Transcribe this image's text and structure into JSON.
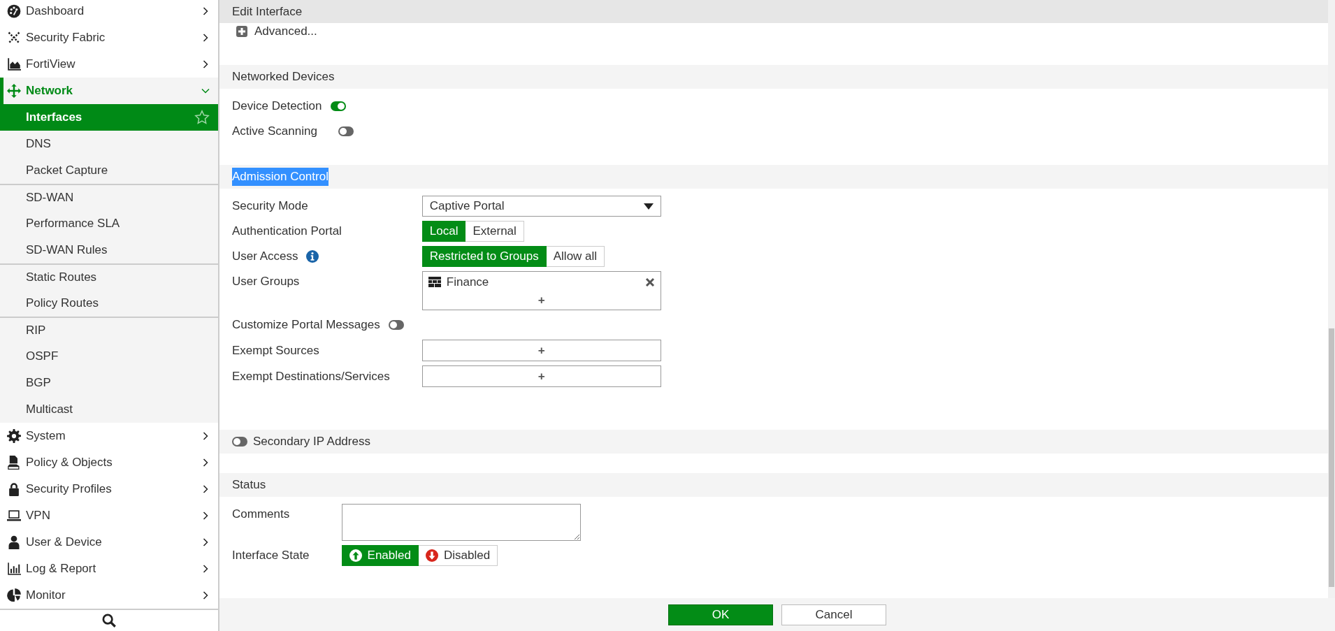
{
  "sidebar": {
    "items": [
      {
        "label": "Dashboard",
        "kind": "dashboard",
        "expanded": false
      },
      {
        "label": "Security Fabric",
        "kind": "fabric",
        "expanded": false
      },
      {
        "label": "FortiView",
        "kind": "area-chart",
        "expanded": false
      },
      {
        "label": "Network",
        "kind": "move",
        "expanded": true,
        "children": [
          {
            "label": "Interfaces",
            "selected": true,
            "section_start": false
          },
          {
            "label": "DNS",
            "selected": false,
            "section_start": false
          },
          {
            "label": "Packet Capture",
            "selected": false,
            "section_start": false
          },
          {
            "label": "SD-WAN",
            "selected": false,
            "section_start": true
          },
          {
            "label": "Performance SLA",
            "selected": false,
            "section_start": false
          },
          {
            "label": "SD-WAN Rules",
            "selected": false,
            "section_start": false
          },
          {
            "label": "Static Routes",
            "selected": false,
            "section_start": true
          },
          {
            "label": "Policy Routes",
            "selected": false,
            "section_start": false
          },
          {
            "label": "RIP",
            "selected": false,
            "section_start": true
          },
          {
            "label": "OSPF",
            "selected": false,
            "section_start": false
          },
          {
            "label": "BGP",
            "selected": false,
            "section_start": false
          },
          {
            "label": "Multicast",
            "selected": false,
            "section_start": false
          }
        ]
      },
      {
        "label": "System",
        "kind": "gear",
        "expanded": false
      },
      {
        "label": "Policy & Objects",
        "kind": "policy",
        "expanded": false
      },
      {
        "label": "Security Profiles",
        "kind": "lock",
        "expanded": false
      },
      {
        "label": "VPN",
        "kind": "laptop",
        "expanded": false
      },
      {
        "label": "User & Device",
        "kind": "user",
        "expanded": false
      },
      {
        "label": "Log & Report",
        "kind": "bar-chart",
        "expanded": false
      },
      {
        "label": "Monitor",
        "kind": "pie",
        "expanded": false
      }
    ]
  },
  "title": "Edit Interface",
  "advanced": {
    "label": "Advanced...",
    "expanded": false
  },
  "sections": [
    {
      "kind": "section",
      "title": "Networked Devices",
      "text_selected": false,
      "rows": [
        {
          "kind": "toggle",
          "label": "Device Detection",
          "on": true
        },
        {
          "kind": "toggle",
          "label": "Active Scanning",
          "on": false
        }
      ]
    },
    {
      "kind": "section",
      "title": "Admission Control",
      "text_selected": true,
      "rows": [
        {
          "kind": "select",
          "label": "Security Mode",
          "value": "Captive Portal"
        },
        {
          "kind": "segmented",
          "label": "Authentication Portal",
          "options": [
            {
              "label": "Local",
              "selected": true
            },
            {
              "label": "External",
              "selected": false
            }
          ]
        },
        {
          "kind": "segmented",
          "label": "User Access",
          "info": true,
          "options": [
            {
              "label": "Restricted to Groups",
              "selected": true
            },
            {
              "label": "Allow all",
              "selected": false
            }
          ]
        },
        {
          "kind": "tags",
          "label": "User Groups",
          "tags": [
            {
              "label": "Finance"
            }
          ],
          "add": "+"
        },
        {
          "kind": "toggle",
          "label": "Customize Portal Messages",
          "on": false
        },
        {
          "kind": "adder",
          "label": "Exempt Sources",
          "add": "+"
        },
        {
          "kind": "adder",
          "label": "Exempt Destinations/Services",
          "add": "+"
        }
      ]
    },
    {
      "kind": "toggle_header",
      "title": "Secondary IP Address",
      "on": false
    },
    {
      "kind": "section",
      "title": "Status",
      "text_selected": false,
      "rows": [
        {
          "kind": "textarea",
          "label": "Comments"
        },
        {
          "kind": "state",
          "label": "Interface State",
          "options": [
            {
              "label": "Enabled",
              "kind": "up",
              "selected": true
            },
            {
              "label": "Disabled",
              "kind": "down",
              "selected": false
            }
          ]
        }
      ]
    }
  ],
  "buttons": [
    {
      "label": "OK",
      "kind": "primary"
    },
    {
      "label": "Cancel",
      "kind": "secondary"
    }
  ]
}
